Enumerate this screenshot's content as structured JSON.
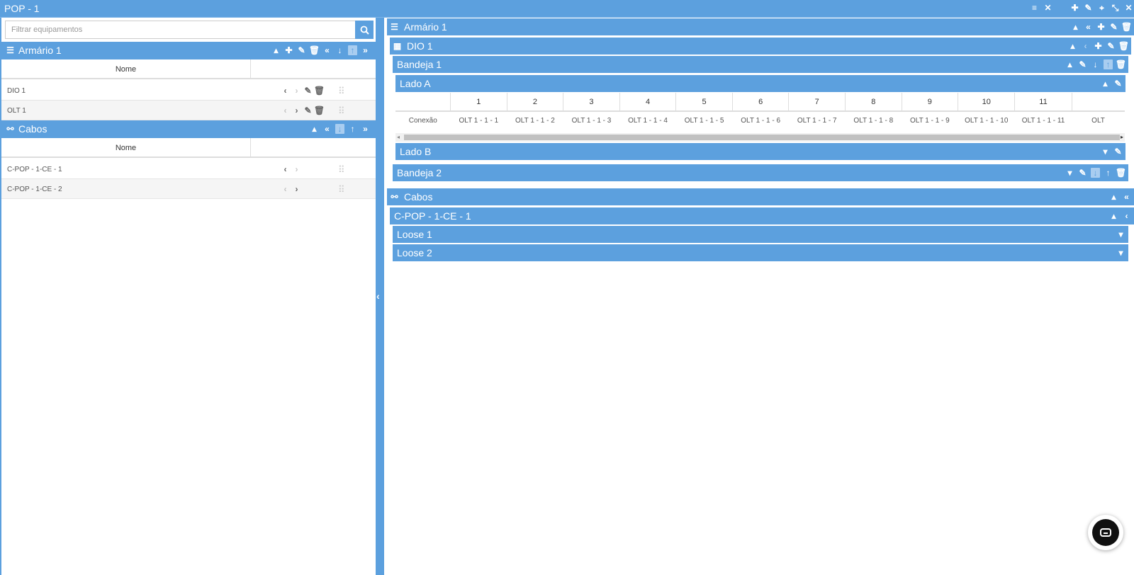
{
  "window": {
    "title": "POP - 1",
    "icons": [
      "list-icon",
      "close-x-icon",
      "add-icon",
      "edit-icon",
      "locate-icon",
      "collapse-icon",
      "close-icon"
    ]
  },
  "left": {
    "search": {
      "placeholder": "Filtrar equipamentos",
      "value": ""
    },
    "cabinet": {
      "title": "Armário 1"
    },
    "equip_table": {
      "header": "Nome",
      "rows": [
        {
          "name": "DIO 1"
        },
        {
          "name": "OLT 1"
        }
      ]
    },
    "cables": {
      "title": "Cabos"
    },
    "cable_table": {
      "header": "Nome",
      "rows": [
        {
          "name": "C-POP - 1-CE - 1"
        },
        {
          "name": "C-POP - 1-CE - 2"
        }
      ]
    }
  },
  "right": {
    "cabinet": {
      "title": "Armário 1"
    },
    "dio": {
      "title": "DIO 1"
    },
    "tray1": {
      "title": "Bandeja 1"
    },
    "sideA": {
      "title": "Lado A"
    },
    "ports": {
      "row_label": "Conexão",
      "numbers": [
        "1",
        "2",
        "3",
        "4",
        "5",
        "6",
        "7",
        "8",
        "9",
        "10",
        "11"
      ],
      "connections": [
        "OLT 1 - 1 - 1",
        "OLT 1 - 1 - 2",
        "OLT 1 - 1 - 3",
        "OLT 1 - 1 - 4",
        "OLT 1 - 1 - 5",
        "OLT 1 - 1 - 6",
        "OLT 1 - 1 - 7",
        "OLT 1 - 1 - 8",
        "OLT 1 - 1 - 9",
        "OLT 1 - 1 - 10",
        "OLT 1 - 1 - 11",
        "OLT"
      ]
    },
    "sideB": {
      "title": "Lado B"
    },
    "tray2": {
      "title": "Bandeja 2"
    },
    "cables": {
      "title": "Cabos"
    },
    "cable1": {
      "title": "C-POP - 1-CE - 1"
    },
    "loose1": {
      "title": "Loose 1"
    },
    "loose2": {
      "title": "Loose 2"
    }
  },
  "colors": {
    "accent": "#5ca0de",
    "panel": "#ffffff"
  }
}
